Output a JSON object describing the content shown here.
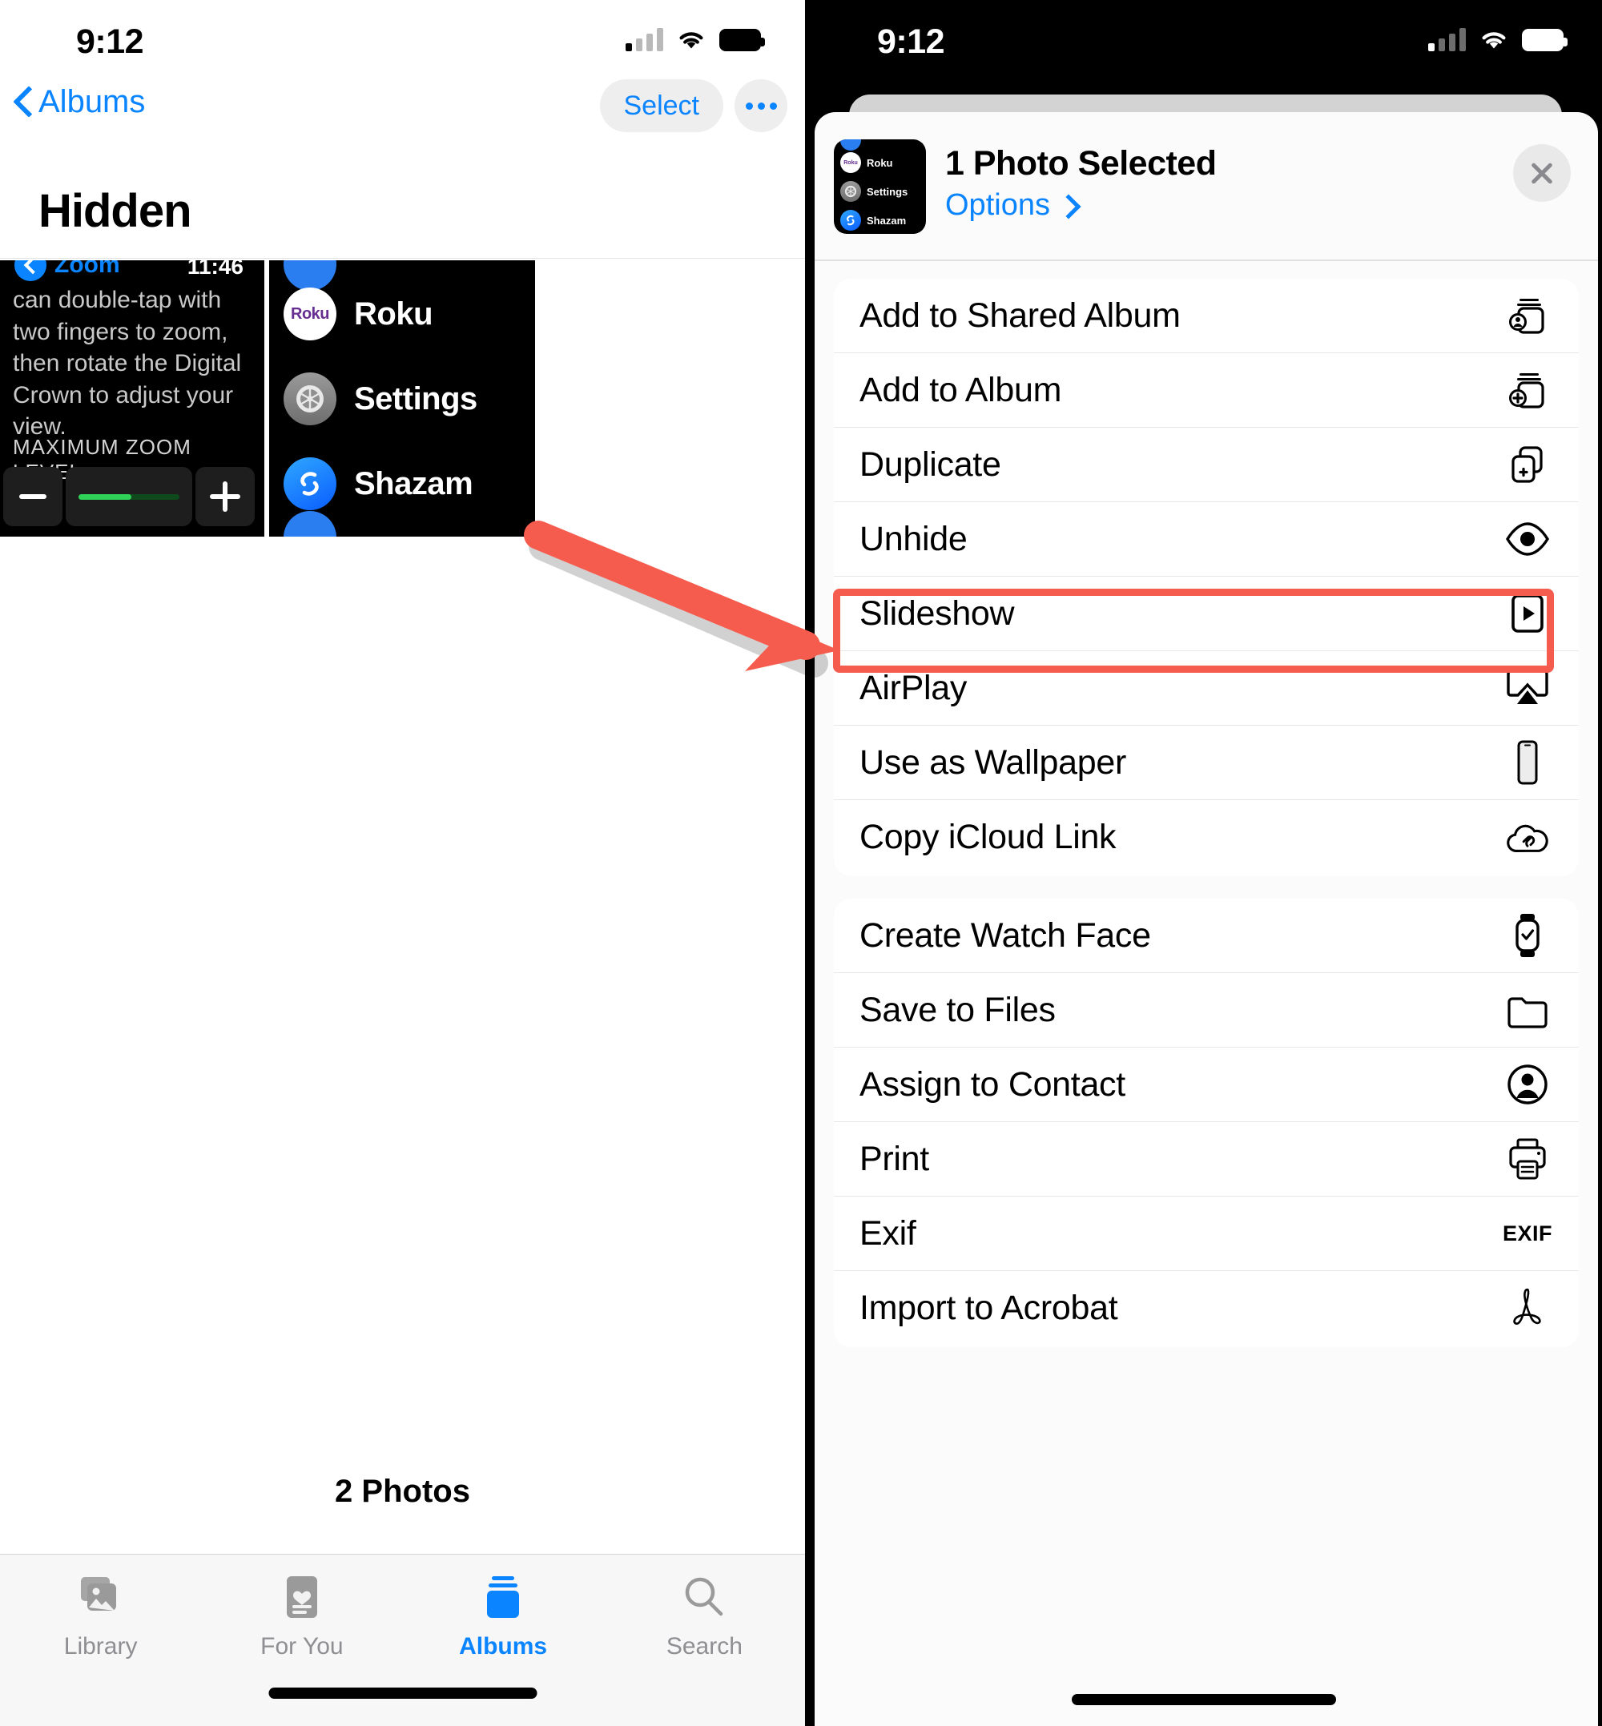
{
  "left_phone": {
    "status": {
      "time": "9:12",
      "cellular_icon": "cellular-signal-icon",
      "wifi_icon": "wifi-icon",
      "battery_icon": "battery-full-icon"
    },
    "navbar": {
      "back_label": "Albums",
      "back_icon": "chevron-left-icon",
      "select_label": "Select",
      "more_icon": "more-ellipsis-icon"
    },
    "page_title": "Hidden",
    "photos": [
      {
        "kind": "watch-zoom-settings-screenshot",
        "header_label": "Zoom",
        "header_time": "11:46",
        "body_text": "can double-tap with two fingers to zoom, then rotate the Digital Crown to adjust your view.",
        "section_label": "MAXIMUM ZOOM LEVEL",
        "minus_icon": "minus-icon",
        "plus_icon": "plus-icon",
        "slider_fill_percent": 52,
        "slider_color": "#30d158"
      },
      {
        "kind": "watch-app-list-screenshot",
        "apps": [
          {
            "name": "Roku",
            "icon": "roku-app-icon",
            "icon_text": "Roku"
          },
          {
            "name": "Settings",
            "icon": "settings-gear-icon"
          },
          {
            "name": "Shazam",
            "icon": "shazam-app-icon"
          }
        ]
      }
    ],
    "photo_count": "2 Photos",
    "tabbar": [
      {
        "label": "Library",
        "icon": "photos-library-icon",
        "active": false
      },
      {
        "label": "For You",
        "icon": "for-you-heart-icon",
        "active": false
      },
      {
        "label": "Albums",
        "icon": "albums-stack-icon",
        "active": true
      },
      {
        "label": "Search",
        "icon": "search-magnifier-icon",
        "active": false
      }
    ]
  },
  "right_phone": {
    "status": {
      "time": "9:12",
      "cellular_icon": "cellular-signal-icon",
      "wifi_icon": "wifi-icon",
      "battery_icon": "battery-full-icon"
    },
    "share_sheet": {
      "title": "1 Photo Selected",
      "options_label": "Options",
      "options_chevron": "chevron-right-icon",
      "close_icon": "close-x-icon",
      "thumbnail": {
        "kind": "watch-app-list-screenshot",
        "apps": [
          {
            "name": "Roku",
            "icon": "roku-app-icon",
            "icon_text": "Roku"
          },
          {
            "name": "Settings",
            "icon": "settings-gear-icon"
          },
          {
            "name": "Shazam",
            "icon": "shazam-app-icon"
          }
        ]
      },
      "groups": [
        {
          "items": [
            {
              "label": "Add to Shared Album",
              "icon": "add-to-shared-album-icon"
            },
            {
              "label": "Add to Album",
              "icon": "add-to-album-icon"
            },
            {
              "label": "Duplicate",
              "icon": "duplicate-icon"
            },
            {
              "label": "Unhide",
              "icon": "eye-icon",
              "highlighted": true
            },
            {
              "label": "Slideshow",
              "icon": "slideshow-play-icon"
            },
            {
              "label": "AirPlay",
              "icon": "airplay-icon"
            },
            {
              "label": "Use as Wallpaper",
              "icon": "wallpaper-phone-icon"
            },
            {
              "label": "Copy iCloud Link",
              "icon": "icloud-link-icon"
            }
          ]
        },
        {
          "items": [
            {
              "label": "Create Watch Face",
              "icon": "apple-watch-icon"
            },
            {
              "label": "Save to Files",
              "icon": "folder-icon"
            },
            {
              "label": "Assign to Contact",
              "icon": "contact-person-icon"
            },
            {
              "label": "Print",
              "icon": "printer-icon"
            },
            {
              "label": "Exif",
              "icon": "exif-text-icon",
              "icon_text": "EXIF"
            },
            {
              "label": "Import to Acrobat",
              "icon": "acrobat-icon"
            }
          ]
        }
      ]
    }
  },
  "annotation": {
    "arrow_color": "#f65c4e",
    "highlight_color": "#f65c4e",
    "highlight_target": "Unhide"
  }
}
